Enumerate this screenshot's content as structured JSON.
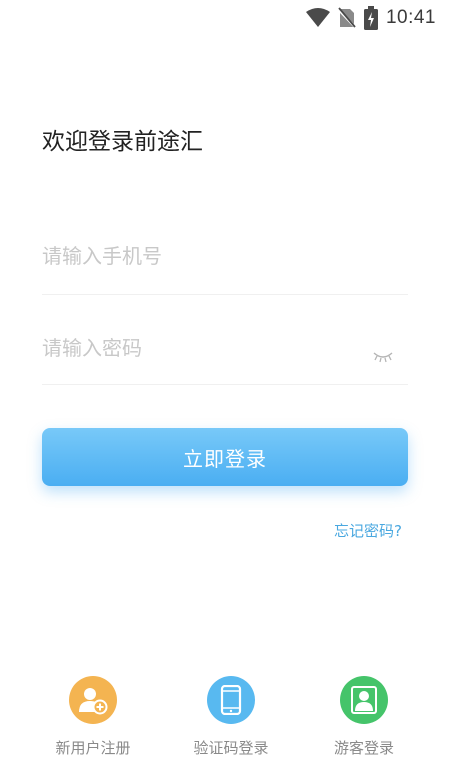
{
  "status_bar": {
    "time": "10:41",
    "icons": [
      "wifi-icon",
      "no-sim-icon",
      "battery-charging-icon"
    ]
  },
  "login": {
    "welcome": "欢迎登录前途汇",
    "phone_placeholder": "请输入手机号",
    "password_placeholder": "请输入密码",
    "submit_label": "立即登录",
    "forgot_label": "忘记密码?"
  },
  "bottom_actions": [
    {
      "label": "新用户注册",
      "icon": "user-add-icon",
      "color": "#f4b451"
    },
    {
      "label": "验证码登录",
      "icon": "phone-icon",
      "color": "#58b9f0"
    },
    {
      "label": "游客登录",
      "icon": "user-icon",
      "color": "#45c46a"
    }
  ],
  "colors": {
    "accent": "#4aaef2",
    "link": "#4aa8e0"
  }
}
